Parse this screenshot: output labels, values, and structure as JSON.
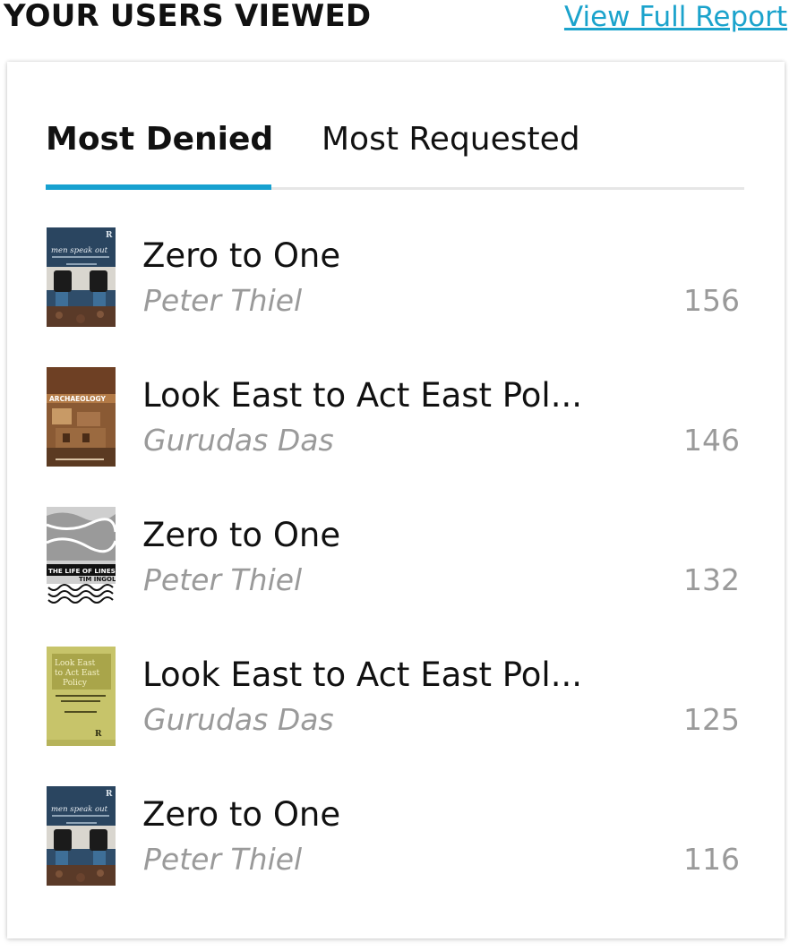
{
  "header": {
    "title": "YOUR USERS VIEWED",
    "report_link": "View Full Report"
  },
  "tabs": [
    {
      "label": "Most Denied",
      "active": true
    },
    {
      "label": "Most Requested",
      "active": false
    }
  ],
  "colors": {
    "accent": "#17a1d0",
    "link": "#1ba3cc",
    "muted_text": "#9a9a9a"
  },
  "books": [
    {
      "title": "Zero to One",
      "author": "Peter Thiel",
      "count": "156",
      "cover": {
        "icon": "book-cover-men-speak-out",
        "line1": "men speak out"
      }
    },
    {
      "title": "Look East to Act East Pol...",
      "author": "Gurudas Das",
      "count": "146",
      "cover": {
        "icon": "book-cover-archaeology",
        "line1": "ARCHAEOLOGY"
      }
    },
    {
      "title": "Zero to One",
      "author": "Peter Thiel",
      "count": "132",
      "cover": {
        "icon": "book-cover-life-of-lines",
        "line1": "THE LIFE OF LINES",
        "line2": "TIM INGOLD"
      }
    },
    {
      "title": "Look East to Act East Pol...",
      "author": "Gurudas Das",
      "count": "125",
      "cover": {
        "icon": "book-cover-look-east",
        "line1": "Look East",
        "line2": "to Act East",
        "line3": "Policy"
      }
    },
    {
      "title": "Zero to One",
      "author": "Peter Thiel",
      "count": "116",
      "cover": {
        "icon": "book-cover-men-speak-out",
        "line1": "men speak out"
      }
    }
  ]
}
